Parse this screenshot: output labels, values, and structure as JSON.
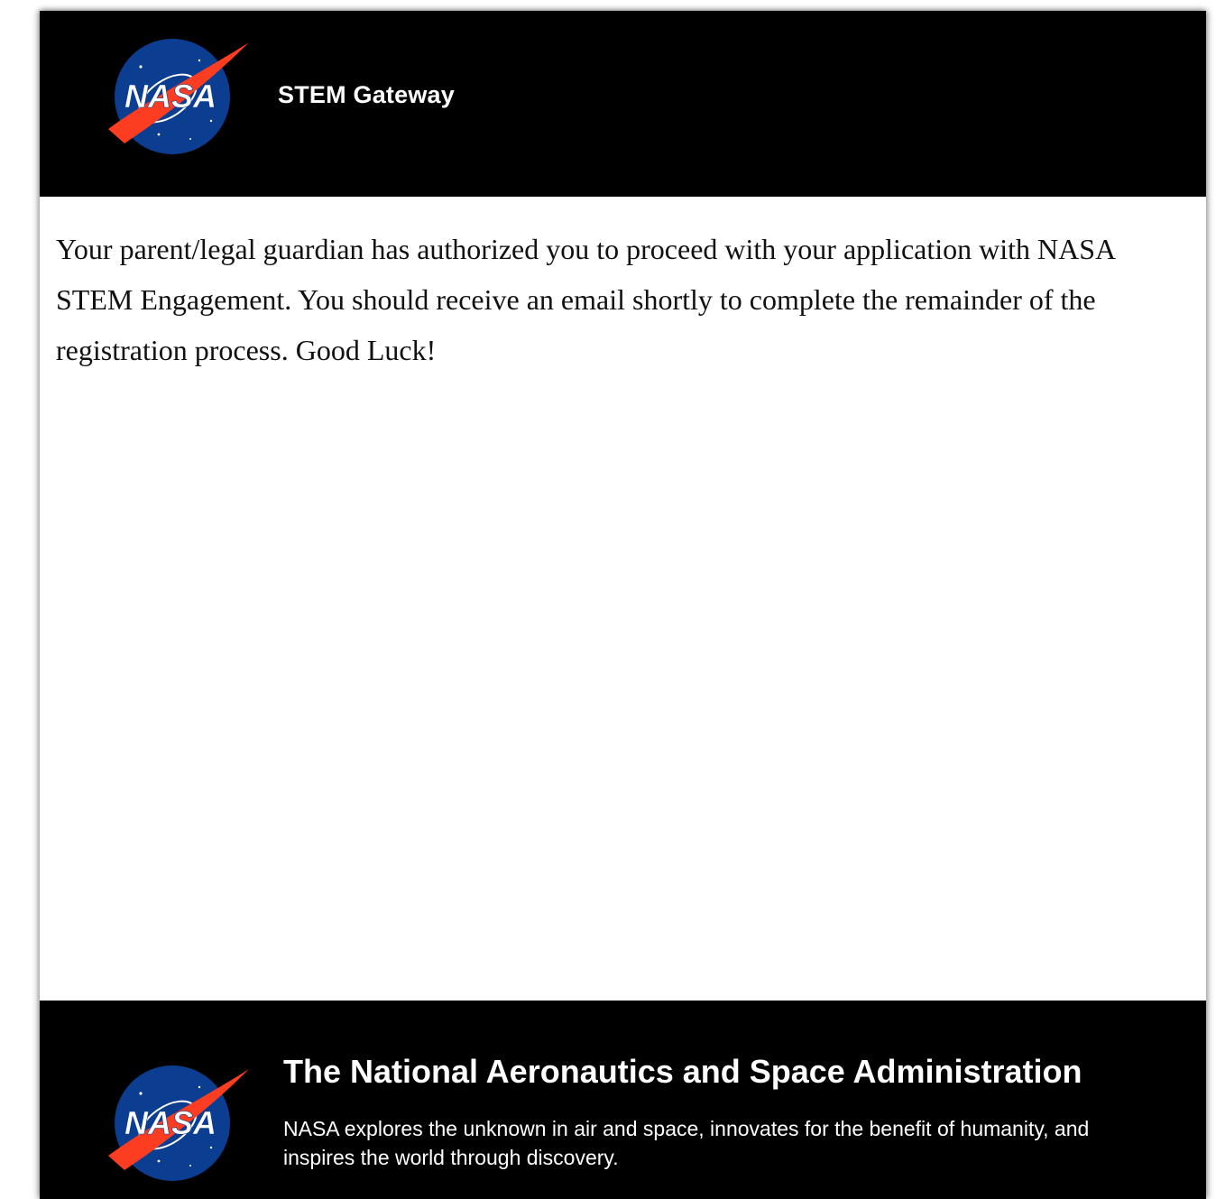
{
  "header": {
    "logo": {
      "icon": "nasa-meatball-logo",
      "text": "NASA"
    },
    "title": "STEM Gateway"
  },
  "main": {
    "message": "Your parent/legal guardian has authorized you to proceed with your application with NASA STEM Engagement. You should receive an email shortly to complete the remainder of the registration process. Good Luck!"
  },
  "footer": {
    "logo": {
      "icon": "nasa-meatball-logo",
      "text": "NASA"
    },
    "heading": "The National Aeronautics and Space Administration",
    "tagline": "NASA explores the unknown in air and space, innovates for the benefit of humanity, and inspires the world through discovery."
  },
  "colors": {
    "bar_background": "#000000",
    "logo_blue": "#0b3d91",
    "logo_red": "#fc3d21",
    "text_dark": "#111111"
  }
}
